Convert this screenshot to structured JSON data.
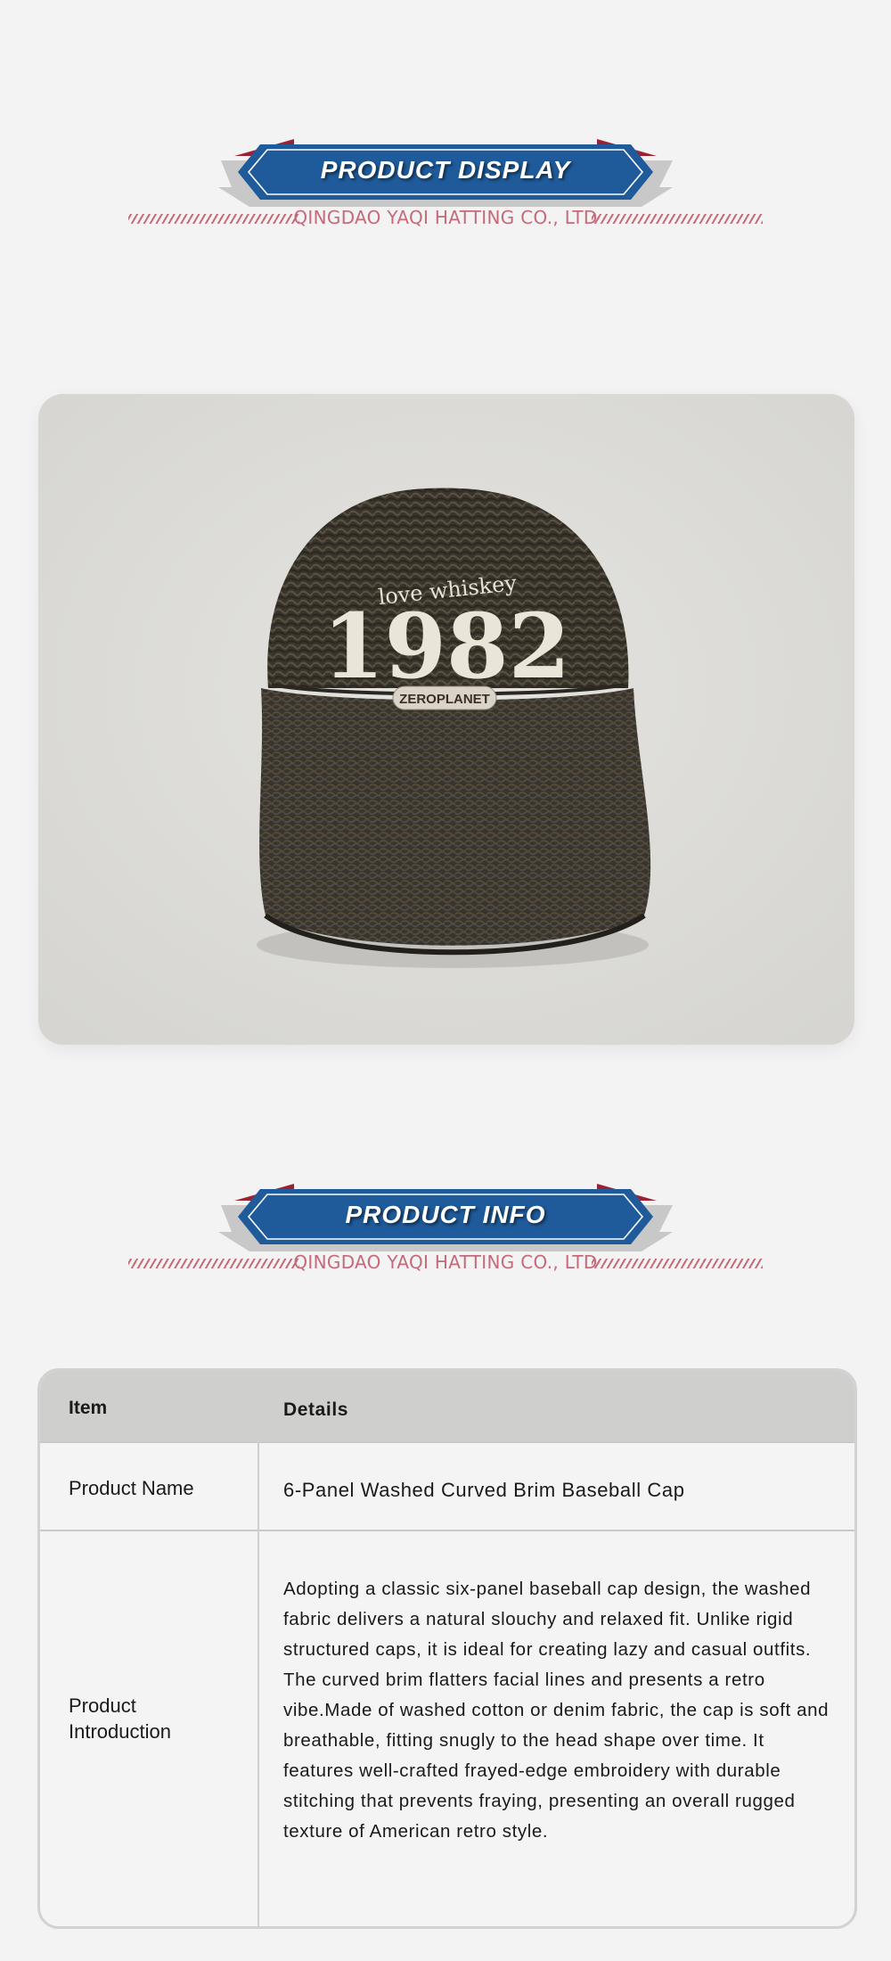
{
  "sections": {
    "display": {
      "title": "PRODUCT DISPLAY",
      "subtitle": "QINGDAO YAQI HATTING CO., LTD"
    },
    "info": {
      "title": "PRODUCT INFO",
      "subtitle": "QINGDAO YAQI HATTING CO., LTD"
    }
  },
  "product_image": {
    "embroidery_script": "love whiskey",
    "embroidery_number": "1982",
    "patch_text": "ZEROPLANET"
  },
  "table": {
    "header": {
      "item": "Item",
      "details": "Details"
    },
    "rows": [
      {
        "item": "Product Name",
        "details": "6-Panel Washed Curved Brim Baseball Cap"
      },
      {
        "item": "Product Introduction",
        "details": "Adopting a classic six-panel baseball cap design, the washed fabric delivers a natural slouchy and relaxed fit. Unlike rigid structured caps, it is ideal for creating lazy and casual outfits. The curved brim flatters facial lines and presents a retro vibe.Made of washed cotton or denim fabric, the cap is soft and breathable, fitting snugly to the head shape over time. It features well-crafted frayed-edge embroidery with durable stitching that prevents fraying, presenting an overall rugged texture of American retro style."
      }
    ]
  },
  "colors": {
    "banner_blue": "#1f5b9a",
    "banner_red": "#9c2233",
    "banner_gray": "#c8c8c8",
    "subtitle_pink": "#c46a7a",
    "page_bg": "#f3f3f3",
    "table_header_bg": "#cfcfce"
  }
}
